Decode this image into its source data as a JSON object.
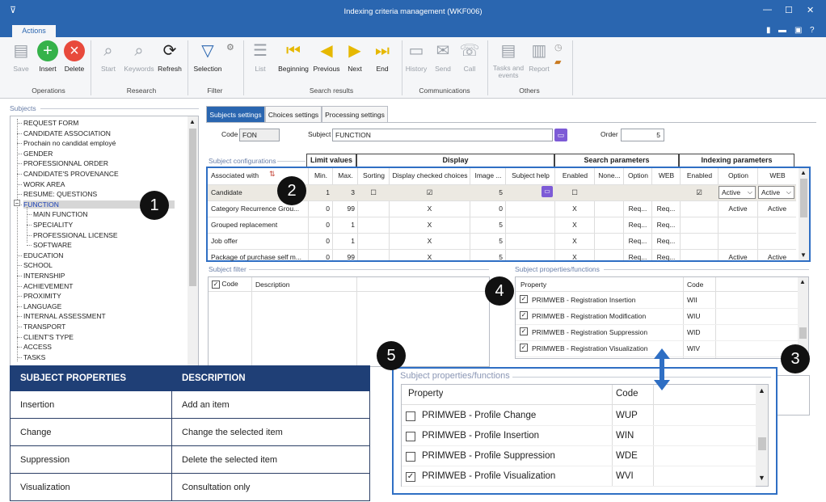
{
  "window": {
    "title": "Indexing criteria management (WKF006)",
    "menu_glyph": "⊽",
    "min": "—",
    "max": "☐",
    "close": "✕"
  },
  "ribbon_tab": "Actions",
  "quick_icons": [
    "phone-icon",
    "calendar-icon",
    "lock-icon",
    "help-icon"
  ],
  "ribbon": {
    "save": "Save",
    "insert": "Insert",
    "delete": "Delete",
    "start": "Start",
    "keywords": "Keywords",
    "refresh": "Refresh",
    "selection": "Selection",
    "list": "List",
    "beginning": "Beginning",
    "previous": "Previous",
    "next": "Next",
    "end": "End",
    "history": "History",
    "send": "Send",
    "call": "Call",
    "tasks": "Tasks and events",
    "report": "Report",
    "groups": {
      "operations": "Operations",
      "research": "Research",
      "filter": "Filter",
      "search_results": "Search results",
      "communications": "Communications",
      "others": "Others"
    }
  },
  "subjects": {
    "label": "Subjects",
    "items": [
      "REQUEST FORM",
      "CANDIDATE ASSOCIATION",
      "Prochain no candidat employé",
      "GENDER",
      "PROFESSIONNAL ORDER",
      "CANDIDATE'S PROVENANCE",
      "WORK AREA",
      "RESUME: QUESTIONS",
      "FUNCTION",
      "MAIN FUNCTION",
      "SPECIALITY",
      "PROFESSIONAL LICENSE",
      "SOFTWARE",
      "EDUCATION",
      "SCHOOL",
      "INTERNSHIP",
      "ACHIEVEMENT",
      "PROXIMITY",
      "LANGUAGE",
      "INTERNAL ASSESSMENT",
      "TRANSPORT",
      "CLIENT'S TYPE",
      "ACCESS",
      "TASKS"
    ]
  },
  "tabs": [
    "Subjects settings",
    "Choices settings",
    "Processing settings"
  ],
  "form": {
    "code_label": "Code",
    "code": "FON",
    "subject_label": "Subject",
    "subject": "FUNCTION",
    "order_label": "Order",
    "order": "5"
  },
  "config": {
    "label": "Subject configurations",
    "group_headers": [
      "Limit values",
      "Display",
      "Search parameters",
      "Indexing parameters"
    ],
    "columns": [
      "Associated with",
      "Min.",
      "Max.",
      "Sorting",
      "Display checked choices",
      "Image ...",
      "Subject help",
      "Enabled",
      "None...",
      "Option",
      "WEB",
      "Enabled",
      "Option",
      "WEB"
    ],
    "rows": [
      [
        "Candidate",
        "1",
        "3",
        "☐",
        "☑",
        "5",
        "",
        "☐",
        "",
        "",
        "",
        "☑",
        "Active",
        "Active"
      ],
      [
        "Category Recurrence Grou...",
        "0",
        "99",
        "",
        "X",
        "0",
        "",
        "X",
        "",
        "Req...",
        "Req...",
        "",
        "Active",
        "Active"
      ],
      [
        "Grouped replacement",
        "0",
        "1",
        "",
        "X",
        "5",
        "",
        "X",
        "",
        "Req...",
        "Req...",
        "",
        "",
        ""
      ],
      [
        "Job offer",
        "0",
        "1",
        "",
        "X",
        "5",
        "",
        "X",
        "",
        "Req...",
        "Req...",
        "",
        "",
        ""
      ],
      [
        "Package of purchase self m...",
        "0",
        "99",
        "",
        "X",
        "5",
        "",
        "X",
        "",
        "Req...",
        "Req...",
        "",
        "Active",
        "Active"
      ]
    ]
  },
  "filter": {
    "label": "Subject filter",
    "code": "Code",
    "description": "Description"
  },
  "props": {
    "label": "Subject properties/functions",
    "property": "Property",
    "code": "Code",
    "rows": [
      [
        "PRIMWEB - Registration Insertion",
        "WII"
      ],
      [
        "PRIMWEB - Registration Modification",
        "WIU"
      ],
      [
        "PRIMWEB - Registration Suppression",
        "WID"
      ],
      [
        "PRIMWEB - Registration Visualization",
        "WIV"
      ]
    ]
  },
  "zoom": {
    "label": "Subject properties/functions",
    "property": "Property",
    "code": "Code",
    "rows": [
      {
        "name": "PRIMWEB - Profile Change",
        "code": "WUP",
        "checked": false
      },
      {
        "name": "PRIMWEB - Profile Insertion",
        "code": "WIN",
        "checked": false
      },
      {
        "name": "PRIMWEB - Profile Suppression",
        "code": "WDE",
        "checked": false
      },
      {
        "name": "PRIMWEB - Profile Visualization",
        "code": "WVI",
        "checked": true
      }
    ]
  },
  "legend": {
    "h1": "SUBJECT PROPERTIES",
    "h2": "DESCRIPTION",
    "rows": [
      [
        "Insertion",
        "Add an item"
      ],
      [
        "Change",
        "Change the selected item"
      ],
      [
        "Suppression",
        "Delete the selected item"
      ],
      [
        "Visualization",
        "Consultation only"
      ]
    ]
  },
  "badges": [
    "1",
    "2",
    "3",
    "4",
    "5"
  ],
  "colors": {
    "title_bar": "#2a66b0",
    "grid_border": "#2f6fc4",
    "table_header": "#1f3f76"
  }
}
